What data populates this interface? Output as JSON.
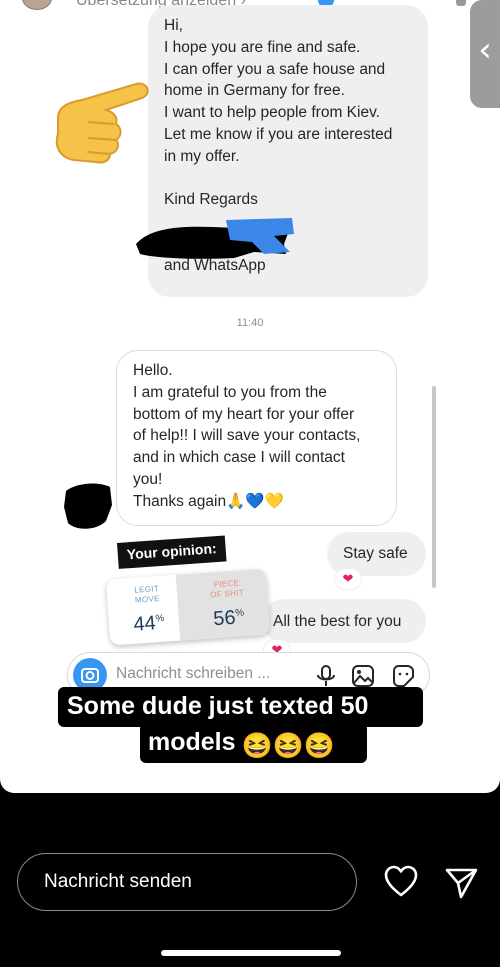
{
  "header": {
    "translate_link": "Übersetzung anzeigen ›"
  },
  "messages": {
    "incoming_1": "Hi,\nI hope you are fine and safe.\nI can offer you a safe house and\nhome in Germany for free.\nI want to help people from Kiev.\nLet me know if you are interested\nin my offer.\n\nKind Regards\n\n                    47 on Telegram\nand WhatsApp",
    "timestamp": "11:40",
    "outgoing_1": "Hello.\nI am grateful to you from the\nbottom of my heart for your offer\nof help!! I will save your contacts,\nand in which case I will contact\nyou!\nThanks again🙏💙💛",
    "stay_safe": "Stay safe",
    "all_the_best": "All the best for you",
    "reaction_emoji": "❤"
  },
  "poll": {
    "title": "Your opinion:",
    "options": [
      {
        "label": "LEGIT\nMOVE",
        "percent": "44",
        "fraction": 0.44
      },
      {
        "label": "PIECE\nOF SHIT",
        "percent": "56",
        "fraction": 0.56
      }
    ],
    "percent_sign": "%"
  },
  "composer": {
    "placeholder": "Nachricht schreiben ..."
  },
  "caption": {
    "line1": "Some dude  just texted 50",
    "line2": "models",
    "emoji": "😆😆😆"
  },
  "footer": {
    "reply_placeholder": "Nachricht senden"
  },
  "colors": {
    "accent_blue": "#3797f0",
    "incoming_bubble": "#efefef",
    "reaction_heart": "#e0245e"
  }
}
